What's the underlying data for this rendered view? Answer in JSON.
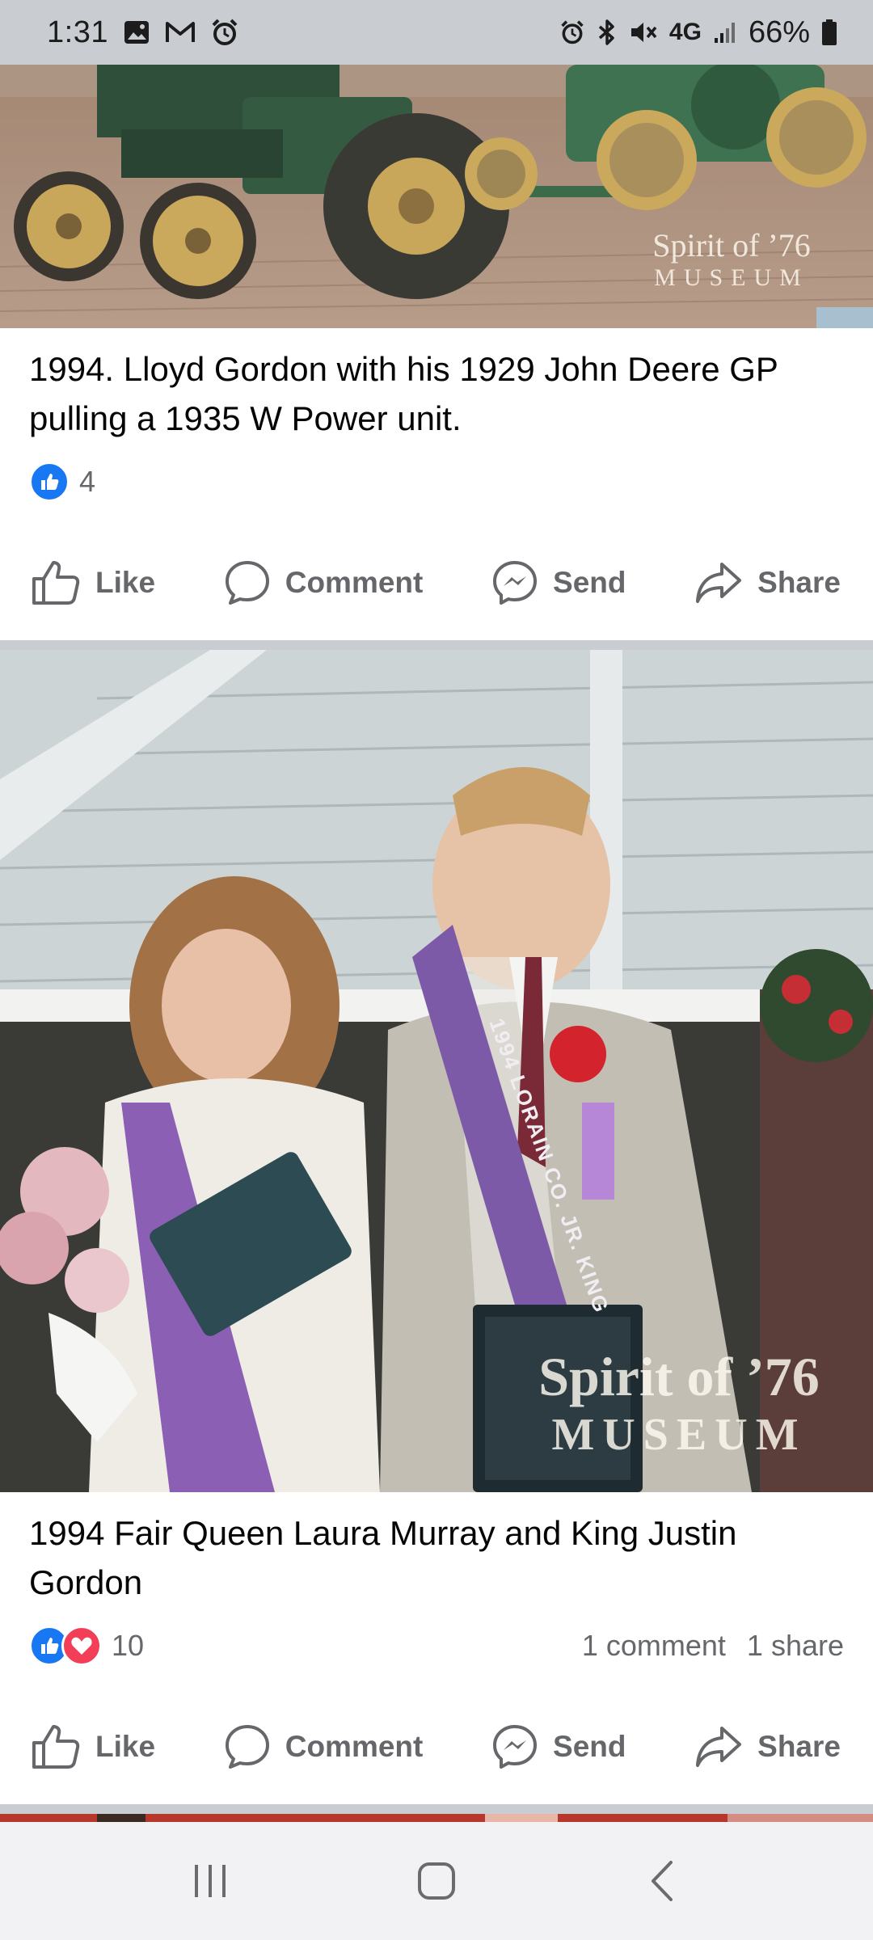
{
  "status_bar": {
    "time": "1:31",
    "network": "4G",
    "battery": "66%",
    "left_icons": [
      "image-icon",
      "gmail-icon",
      "alarm-icon"
    ],
    "right_icons": [
      "alarm-icon",
      "bluetooth-icon",
      "mute-icon",
      "signal-icon",
      "battery-icon"
    ]
  },
  "posts": [
    {
      "watermark_line1": "Spirit of ’76",
      "watermark_line2": "MUSEUM",
      "caption": "1994. Lloyd Gordon with his 1929 John Deere GP pulling a 1935 W Power unit.",
      "reaction_count": "4",
      "comments": "",
      "shares": "",
      "actions": {
        "like": "Like",
        "comment": "Comment",
        "send": "Send",
        "share": "Share"
      }
    },
    {
      "watermark_line1": "Spirit of ’76",
      "watermark_line2": "MUSEUM",
      "caption": "1994 Fair Queen Laura Murray and King Justin Gordon",
      "reaction_count": "10",
      "comments": "1 comment",
      "shares": "1 share",
      "sash_text": "1994 LORAIN CO. JR. KING",
      "actions": {
        "like": "Like",
        "comment": "Comment",
        "send": "Send",
        "share": "Share"
      }
    }
  ],
  "colors": {
    "like_blue": "#1877f2",
    "love_red": "#f33e58",
    "secondary_text": "#65676b",
    "divider": "#c9ccd1"
  },
  "nav_bar": {
    "icons": [
      "recents-icon",
      "home-icon",
      "back-icon"
    ]
  }
}
